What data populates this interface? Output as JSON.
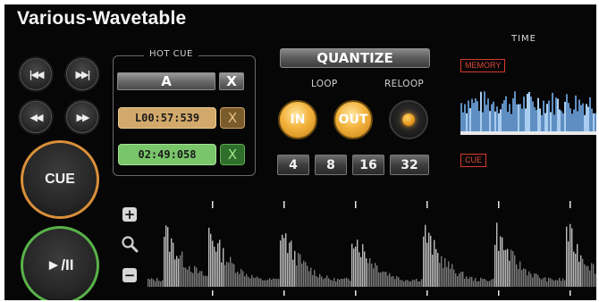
{
  "deck": {
    "title": "Various-Wavetable",
    "time_label": "TIME"
  },
  "transport": {
    "prev_track_icon": "skip-back-icon",
    "next_track_icon": "skip-forward-icon",
    "rewind_icon": "rewind-icon",
    "fast_forward_icon": "fast-forward-icon",
    "cue_label": "CUE",
    "play_pause_label": "►/II"
  },
  "hot_cue": {
    "title": "HOT CUE",
    "header_label": "A",
    "header_delete": "X",
    "slots": [
      {
        "time": "L00:57:539",
        "delete": "X",
        "color": "#d2a96a"
      },
      {
        "time": "02:49:058",
        "delete": "X",
        "color": "#79c66a"
      }
    ]
  },
  "loop": {
    "quantize_label": "QUANTIZE",
    "loop_label": "LOOP",
    "reloop_label": "RELOOP",
    "in_label": "IN",
    "out_label": "OUT",
    "beats": [
      "4",
      "8",
      "16",
      "32"
    ]
  },
  "overview": {
    "memory_tag": "MEMORY",
    "cue_tag": "CUE"
  },
  "zoom": {
    "in_icon": "plus-icon",
    "reset_icon": "magnifier-icon",
    "out_icon": "minus-icon"
  },
  "colors": {
    "accent_cue": "#d98f3a",
    "accent_play": "#59b24a",
    "loop_orange": "#f3b33d",
    "tag_red": "#d8392c"
  }
}
